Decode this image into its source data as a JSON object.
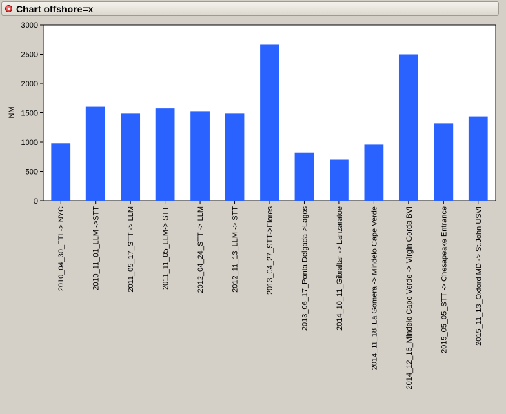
{
  "report": {
    "title": "Chart offshore=x"
  },
  "colors": {
    "bar": "#2962ff",
    "plot_background": "#ffffff",
    "page_background": "#d4d0c8"
  },
  "chart_data": {
    "type": "bar",
    "title": "",
    "xlabel": "",
    "ylabel": "NM",
    "ylim": [
      0,
      3000
    ],
    "yticks": [
      0,
      500,
      1000,
      1500,
      2000,
      2500,
      3000
    ],
    "grid": false,
    "categories": [
      "2010_04_30_FTL-> NYC",
      "2010_11_01_LLM ->STT",
      "2011_05_17_STT -> LLM",
      "2011_11_05_LLM-> STT",
      "2012_04_24_STT -> LLM",
      "2012_11_13_LLM -> STT",
      "2013_04_27_STT->Flores",
      "2013_06_17_Ponta Delgada->Lagos",
      "2014_10_11_Gibraltar -> Lanzaratoe",
      "2014_11_18_La Gomera -> Mindelo Cape Verde",
      "2014_12_16_Mindelo Capo Verde -> Virgin Gorda BVI",
      "2015_05_05_STT -> Chesapeake Entrance",
      "2015_11_13_Oxford MD -> St.John USVI"
    ],
    "values": [
      985,
      1605,
      1490,
      1575,
      1525,
      1490,
      2665,
      815,
      700,
      960,
      2500,
      1325,
      1440
    ]
  }
}
